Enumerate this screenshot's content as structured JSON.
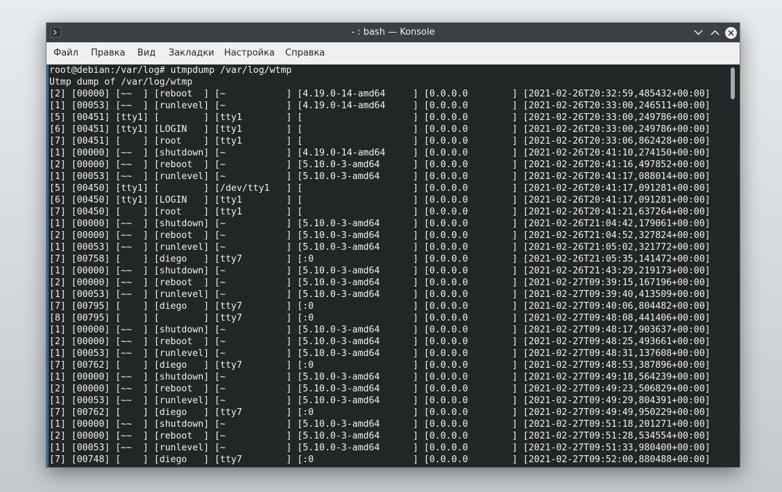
{
  "window": {
    "title": "- : bash — Konsole"
  },
  "menu": {
    "items": [
      "Файл",
      "Правка",
      "Вид",
      "Закладки",
      "Настройка",
      "Справка"
    ]
  },
  "terminal": {
    "lines": [
      "root@debian:/var/log# utmpdump /var/log/wtmp",
      "Utmp dump of /var/log/wtmp",
      "[2] [00000] [~~  ] [reboot  ] [~           ] [4.19.0-14-amd64     ] [0.0.0.0        ] [2021-02-26T20:32:59,485432+00:00]",
      "[1] [00053] [~~  ] [runlevel] [~           ] [4.19.0-14-amd64     ] [0.0.0.0        ] [2021-02-26T20:33:00,246511+00:00]",
      "[5] [00451] [tty1] [        ] [tty1        ] [                    ] [0.0.0.0        ] [2021-02-26T20:33:00,249786+00:00]",
      "[6] [00451] [tty1] [LOGIN   ] [tty1        ] [                    ] [0.0.0.0        ] [2021-02-26T20:33:00,249786+00:00]",
      "[7] [00451] [    ] [root    ] [tty1        ] [                    ] [0.0.0.0        ] [2021-02-26T20:33:06,862428+00:00]",
      "[1] [00000] [~~  ] [shutdown] [~           ] [4.19.0-14-amd64     ] [0.0.0.0        ] [2021-02-26T20:41:10,274150+00:00]",
      "[2] [00000] [~~  ] [reboot  ] [~           ] [5.10.0-3-amd64      ] [0.0.0.0        ] [2021-02-26T20:41:16,497852+00:00]",
      "[1] [00053] [~~  ] [runlevel] [~           ] [5.10.0-3-amd64      ] [0.0.0.0        ] [2021-02-26T20:41:17,088014+00:00]",
      "[5] [00450] [tty1] [        ] [/dev/tty1   ] [                    ] [0.0.0.0        ] [2021-02-26T20:41:17,091281+00:00]",
      "[6] [00450] [tty1] [LOGIN   ] [tty1        ] [                    ] [0.0.0.0        ] [2021-02-26T20:41:17,091281+00:00]",
      "[7] [00450] [    ] [root    ] [tty1        ] [                    ] [0.0.0.0        ] [2021-02-26T20:41:21,637264+00:00]",
      "[1] [00000] [~~  ] [shutdown] [~           ] [5.10.0-3-amd64      ] [0.0.0.0        ] [2021-02-26T21:04:42,179061+00:00]",
      "[2] [00000] [~~  ] [reboot  ] [~           ] [5.10.0-3-amd64      ] [0.0.0.0        ] [2021-02-26T21:04:52,327824+00:00]",
      "[1] [00053] [~~  ] [runlevel] [~           ] [5.10.0-3-amd64      ] [0.0.0.0        ] [2021-02-26T21:05:02,321772+00:00]",
      "[7] [00758] [    ] [diego   ] [tty7        ] [:0                  ] [0.0.0.0        ] [2021-02-26T21:05:35,141472+00:00]",
      "[1] [00000] [~~  ] [shutdown] [~           ] [5.10.0-3-amd64      ] [0.0.0.0        ] [2021-02-26T21:43:29,219173+00:00]",
      "[2] [00000] [~~  ] [reboot  ] [~           ] [5.10.0-3-amd64      ] [0.0.0.0        ] [2021-02-27T09:39:15,167196+00:00]",
      "[1] [00053] [~~  ] [runlevel] [~           ] [5.10.0-3-amd64      ] [0.0.0.0        ] [2021-02-27T09:39:40,413509+00:00]",
      "[7] [00795] [    ] [diego   ] [tty7        ] [:0                  ] [0.0.0.0        ] [2021-02-27T09:40:06,804482+00:00]",
      "[8] [00795] [    ] [        ] [tty7        ] [:0                  ] [0.0.0.0        ] [2021-02-27T09:48:08,441406+00:00]",
      "[1] [00000] [~~  ] [shutdown] [~           ] [5.10.0-3-amd64      ] [0.0.0.0        ] [2021-02-27T09:48:17,903637+00:00]",
      "[2] [00000] [~~  ] [reboot  ] [~           ] [5.10.0-3-amd64      ] [0.0.0.0        ] [2021-02-27T09:48:25,493661+00:00]",
      "[1] [00053] [~~  ] [runlevel] [~           ] [5.10.0-3-amd64      ] [0.0.0.0        ] [2021-02-27T09:48:31,137608+00:00]",
      "[7] [00762] [    ] [diego   ] [tty7        ] [:0                  ] [0.0.0.0        ] [2021-02-27T09:48:53,387896+00:00]",
      "[1] [00000] [~~  ] [shutdown] [~           ] [5.10.0-3-amd64      ] [0.0.0.0        ] [2021-02-27T09:49:18,564239+00:00]",
      "[2] [00000] [~~  ] [reboot  ] [~           ] [5.10.0-3-amd64      ] [0.0.0.0        ] [2021-02-27T09:49:23,506829+00:00]",
      "[1] [00053] [~~  ] [runlevel] [~           ] [5.10.0-3-amd64      ] [0.0.0.0        ] [2021-02-27T09:49:29,804391+00:00]",
      "[7] [00762] [    ] [diego   ] [tty7        ] [:0                  ] [0.0.0.0        ] [2021-02-27T09:49:49,950229+00:00]",
      "[1] [00000] [~~  ] [shutdown] [~           ] [5.10.0-3-amd64      ] [0.0.0.0        ] [2021-02-27T09:51:18,201271+00:00]",
      "[2] [00000] [~~  ] [reboot  ] [~           ] [5.10.0-3-amd64      ] [0.0.0.0        ] [2021-02-27T09:51:28,534554+00:00]",
      "[1] [00053] [~~  ] [runlevel] [~           ] [5.10.0-3-amd64      ] [0.0.0.0        ] [2021-02-27T09:51:33,980400+00:00]",
      "[7] [00748] [    ] [diego   ] [tty7        ] [:0                  ] [0.0.0.0        ] [2021-02-27T09:52:00,880488+00:00]"
    ]
  },
  "icons": {
    "app": "terminal-icon",
    "minimize": "chevron-down-icon",
    "maximize": "chevron-up-icon",
    "close": "close-icon"
  },
  "colors": {
    "titlebar": "#3c4044",
    "menubar": "#eff0f1",
    "terminal_bg": "#232627",
    "terminal_fg": "#eff0f1",
    "accent": "#2d6ba3"
  }
}
